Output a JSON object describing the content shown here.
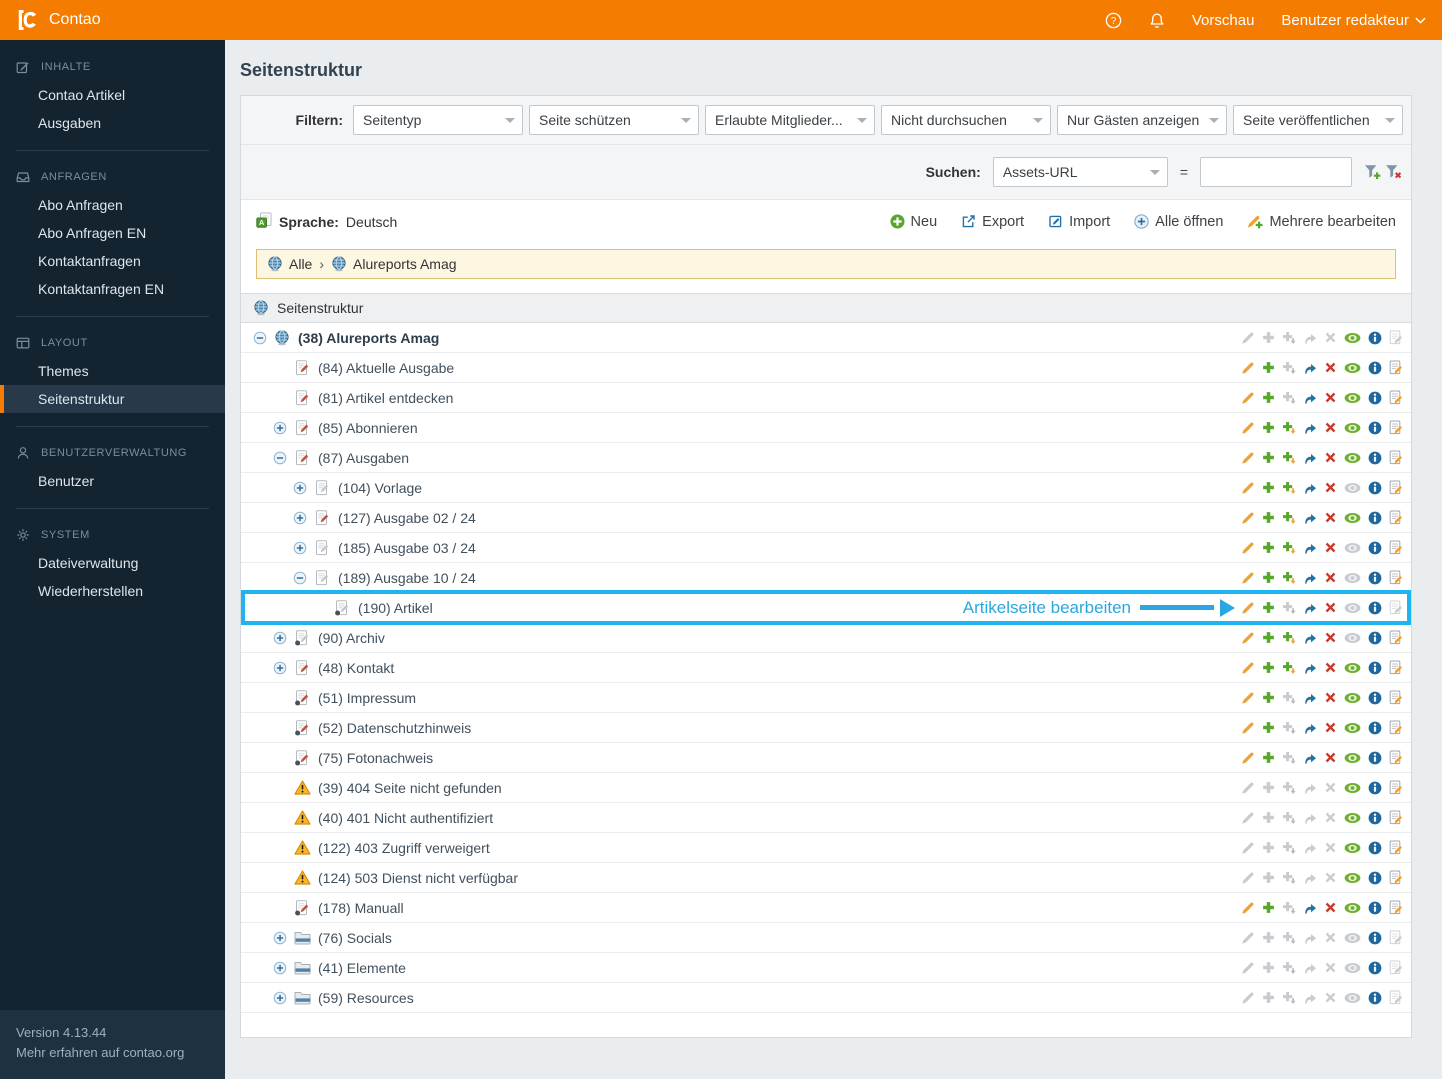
{
  "header": {
    "brand": "Contao",
    "preview_label": "Vorschau",
    "user_menu_label": "Benutzer redakteur"
  },
  "sidebar": {
    "sections": [
      {
        "label": "INHALTE",
        "icon": "edit-icon",
        "items": [
          {
            "label": "Contao Artikel"
          },
          {
            "label": "Ausgaben"
          }
        ]
      },
      {
        "label": "ANFRAGEN",
        "icon": "inbox-icon",
        "items": [
          {
            "label": "Abo Anfragen"
          },
          {
            "label": "Abo Anfragen EN"
          },
          {
            "label": "Kontaktanfragen"
          },
          {
            "label": "Kontaktanfragen EN"
          }
        ]
      },
      {
        "label": "LAYOUT",
        "icon": "layout-icon",
        "items": [
          {
            "label": "Themes"
          },
          {
            "label": "Seitenstruktur",
            "active": true
          }
        ]
      },
      {
        "label": "BENUTZERVERWALTUNG",
        "icon": "user-icon",
        "items": [
          {
            "label": "Benutzer"
          }
        ]
      },
      {
        "label": "SYSTEM",
        "icon": "gear-icon",
        "items": [
          {
            "label": "Dateiverwaltung"
          },
          {
            "label": "Wiederherstellen"
          }
        ]
      }
    ],
    "footer": {
      "version": "Version 4.13.44",
      "more": "Mehr erfahren auf contao.org"
    }
  },
  "page": {
    "title": "Seitenstruktur"
  },
  "filters": {
    "label": "Filtern:",
    "selects": [
      "Seitentyp",
      "Seite schützen",
      "Erlaubte Mitglieder...",
      "Nicht durchsuchen",
      "Nur Gästen anzeigen",
      "Seite veröffentlichen"
    ]
  },
  "search": {
    "label": "Suchen:",
    "field": "Assets-URL",
    "equals": "=",
    "value": ""
  },
  "toolbar": {
    "language_label": "Sprache:",
    "language_value": "Deutsch",
    "buttons": [
      {
        "label": "Neu",
        "icon": "new-icon"
      },
      {
        "label": "Export",
        "icon": "export-icon"
      },
      {
        "label": "Import",
        "icon": "import-icon"
      },
      {
        "label": "Alle öffnen",
        "icon": "expand-all-icon"
      },
      {
        "label": "Mehrere bearbeiten",
        "icon": "edit-multiple-icon"
      }
    ]
  },
  "breadcrumb": {
    "items": [
      "Alle",
      "Alureports Amag"
    ],
    "separator": "›"
  },
  "tree": {
    "header": "Seitenstruktur",
    "annotation": {
      "text": "Artikelseite bearbeiten",
      "color": "#2aa7e0"
    },
    "action_order": [
      "edit",
      "copy",
      "copy-children",
      "move",
      "delete",
      "visibility",
      "info",
      "edit-articles"
    ],
    "rows": [
      {
        "level": 0,
        "toggle": "minus",
        "icon": "globe",
        "label": "(38) Alureports Amag",
        "bold": true,
        "actions": [
          0,
          0,
          0,
          0,
          0,
          1,
          1,
          0
        ]
      },
      {
        "level": 1,
        "toggle": "none",
        "icon": "page-red",
        "label": "(84) Aktuelle Ausgabe",
        "actions": [
          1,
          1,
          0,
          1,
          1,
          1,
          1,
          1
        ]
      },
      {
        "level": 1,
        "toggle": "none",
        "icon": "page-red",
        "label": "(81) Artikel entdecken",
        "actions": [
          1,
          1,
          0,
          1,
          1,
          1,
          1,
          1
        ]
      },
      {
        "level": 1,
        "toggle": "plus",
        "icon": "page-red",
        "label": "(85) Abonnieren",
        "actions": [
          1,
          1,
          1,
          1,
          1,
          1,
          1,
          1
        ]
      },
      {
        "level": 1,
        "toggle": "minus",
        "icon": "page-red",
        "label": "(87) Ausgaben",
        "actions": [
          1,
          1,
          1,
          1,
          1,
          1,
          1,
          1
        ]
      },
      {
        "level": 2,
        "toggle": "plus",
        "icon": "page-gray",
        "label": "(104) Vorlage",
        "actions": [
          1,
          1,
          1,
          1,
          1,
          0,
          1,
          1
        ]
      },
      {
        "level": 2,
        "toggle": "plus",
        "icon": "page-red",
        "label": "(127) Ausgabe 02 / 24",
        "actions": [
          1,
          1,
          1,
          1,
          1,
          1,
          1,
          1
        ]
      },
      {
        "level": 2,
        "toggle": "plus",
        "icon": "page-gray",
        "label": "(185) Ausgabe 03 / 24",
        "actions": [
          1,
          1,
          1,
          1,
          1,
          0,
          1,
          1
        ]
      },
      {
        "level": 2,
        "toggle": "minus",
        "icon": "page-gray",
        "label": "(189) Ausgabe 10 / 24",
        "actions": [
          1,
          1,
          1,
          1,
          1,
          0,
          1,
          1
        ]
      },
      {
        "level": 3,
        "toggle": "none",
        "icon": "page-hidden-gray",
        "label": "(190) Artikel",
        "highlight": true,
        "actions": [
          1,
          1,
          0,
          1,
          1,
          0,
          1,
          0
        ]
      },
      {
        "level": 1,
        "toggle": "plus",
        "icon": "page-hidden-gray",
        "label": "(90) Archiv",
        "actions": [
          1,
          1,
          1,
          1,
          1,
          0,
          1,
          1
        ]
      },
      {
        "level": 1,
        "toggle": "plus",
        "icon": "page-red",
        "label": "(48) Kontakt",
        "actions": [
          1,
          1,
          1,
          1,
          1,
          1,
          1,
          1
        ]
      },
      {
        "level": 1,
        "toggle": "none",
        "icon": "page-hidden-red",
        "label": "(51) Impressum",
        "actions": [
          1,
          1,
          0,
          1,
          1,
          1,
          1,
          1
        ]
      },
      {
        "level": 1,
        "toggle": "none",
        "icon": "page-hidden-red",
        "label": "(52) Datenschutzhinweis",
        "actions": [
          1,
          1,
          0,
          1,
          1,
          1,
          1,
          1
        ]
      },
      {
        "level": 1,
        "toggle": "none",
        "icon": "page-hidden-red",
        "label": "(75) Fotonachweis",
        "actions": [
          1,
          1,
          0,
          1,
          1,
          1,
          1,
          1
        ]
      },
      {
        "level": 1,
        "toggle": "none",
        "icon": "warning",
        "label": "(39) 404 Seite nicht gefunden",
        "actions": [
          0,
          0,
          0,
          0,
          0,
          1,
          1,
          1
        ]
      },
      {
        "level": 1,
        "toggle": "none",
        "icon": "warning",
        "label": "(40) 401 Nicht authentifiziert",
        "actions": [
          0,
          0,
          0,
          0,
          0,
          1,
          1,
          1
        ]
      },
      {
        "level": 1,
        "toggle": "none",
        "icon": "warning",
        "label": "(122) 403 Zugriff verweigert",
        "actions": [
          0,
          0,
          0,
          0,
          0,
          1,
          1,
          1
        ]
      },
      {
        "level": 1,
        "toggle": "none",
        "icon": "warning",
        "label": "(124) 503 Dienst nicht verfügbar",
        "actions": [
          0,
          0,
          0,
          0,
          0,
          1,
          1,
          1
        ]
      },
      {
        "level": 1,
        "toggle": "none",
        "icon": "page-hidden-red",
        "label": "(178) Manuall",
        "actions": [
          1,
          1,
          0,
          1,
          1,
          1,
          1,
          1
        ]
      },
      {
        "level": 1,
        "toggle": "plus",
        "icon": "folder",
        "label": "(76) Socials",
        "actions": [
          0,
          0,
          0,
          0,
          0,
          0,
          1,
          0
        ]
      },
      {
        "level": 1,
        "toggle": "plus",
        "icon": "folder",
        "label": "(41) Elemente",
        "actions": [
          0,
          0,
          0,
          0,
          0,
          0,
          1,
          0
        ]
      },
      {
        "level": 1,
        "toggle": "plus",
        "icon": "folder",
        "label": "(59) Resources",
        "actions": [
          0,
          0,
          0,
          0,
          0,
          0,
          1,
          0
        ]
      }
    ]
  },
  "colors": {
    "accent": "#f47c00",
    "highlight": "#1db4f0",
    "annotation": "#2aa7e0"
  }
}
